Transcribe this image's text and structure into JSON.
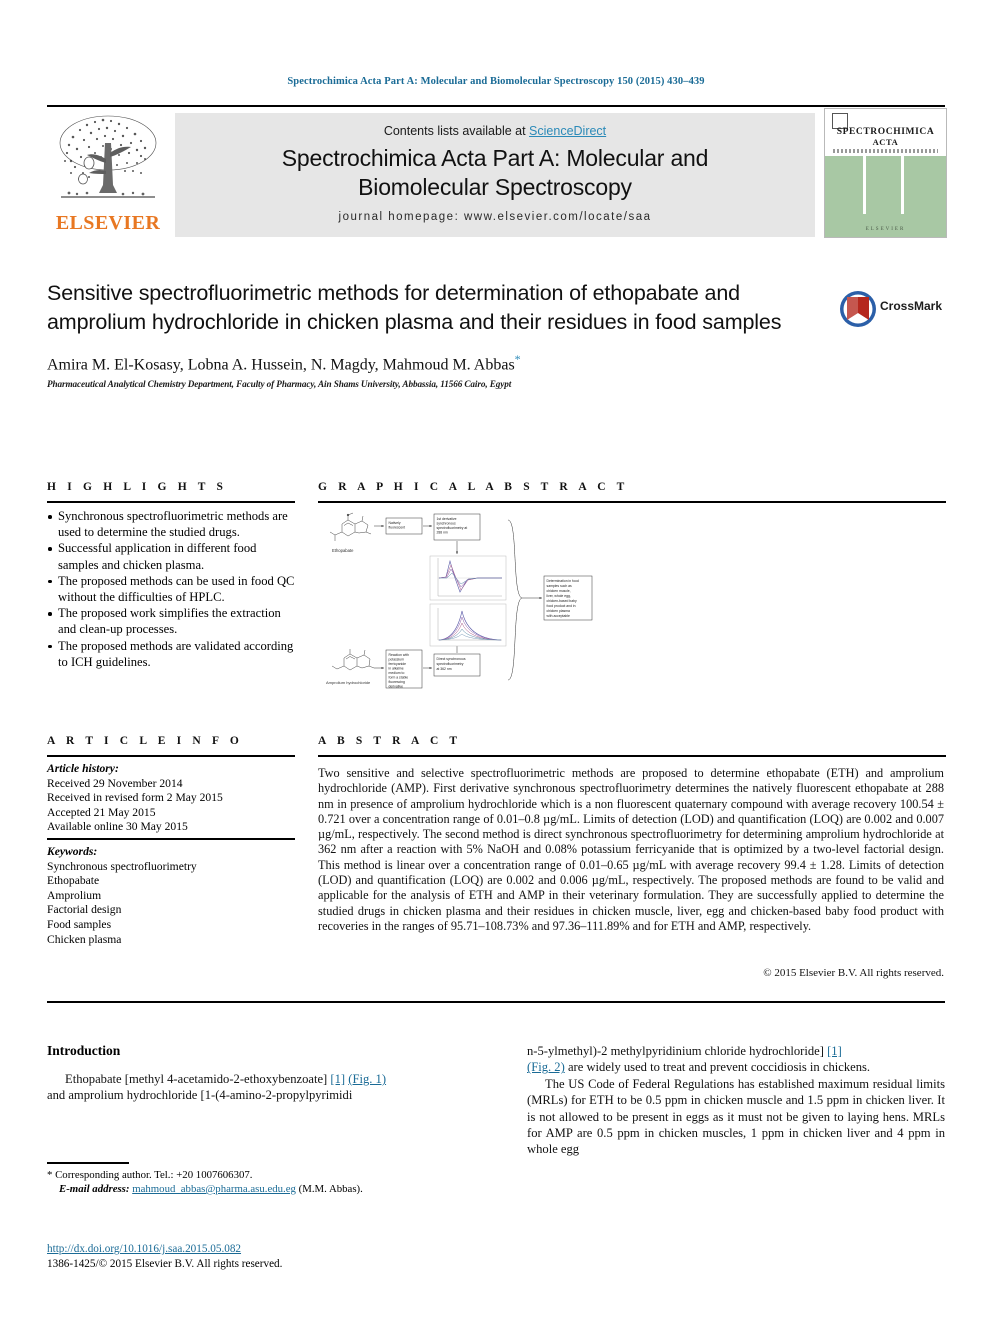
{
  "running_head": "Spectrochimica Acta Part A: Molecular and Biomolecular Spectroscopy 150 (2015) 430–439",
  "masthead": {
    "contents_prefix": "Contents lists available at ",
    "sciencedirect": "ScienceDirect",
    "journal_title_line1": "Spectrochimica Acta Part A: Molecular and",
    "journal_title_line2": "Biomolecular Spectroscopy",
    "homepage": "journal homepage: www.elsevier.com/locate/saa",
    "publisher": "ELSEVIER",
    "cover": {
      "line1": "SPECTROCHIMICA",
      "line2": "ACTA",
      "caption": "ELSEVIER"
    }
  },
  "article": {
    "title": "Sensitive spectrofluorimetric methods for determination of ethopabate and amprolium hydrochloride in chicken plasma and their residues in food samples",
    "authors": "Amira M. El-Kosasy, Lobna A. Hussein, N. Magdy, Mahmoud M. Abbas",
    "corresponding_mark": "*",
    "affiliation": "Pharmaceutical Analytical Chemistry Department, Faculty of Pharmacy, Ain Shams University, Abbassia, 11566 Cairo, Egypt",
    "crossmark_label": "CrossMark"
  },
  "highlights": {
    "heading": "H I G H L I G H T S",
    "items": [
      "Synchronous spectrofluorimetric methods are used to determine the studied drugs.",
      "Successful application in different food samples and chicken plasma.",
      "The proposed methods can be used in food QC without the difficulties of HPLC.",
      "The proposed work simplifies the extraction and clean-up processes.",
      "The proposed methods are validated according to ICH guidelines."
    ]
  },
  "graphical_abstract": {
    "heading": "G R A P H I C A L   A B S T R A C T",
    "nodes": {
      "ethopabate_label": "Ethopabate",
      "amprolium_label": "Amprolium hydrochloride",
      "box_natively": "Natively fluorescent",
      "box_first_deriv": "1st derivative synchronous spectrofluorimetry at 288 nm",
      "box_reaction": "Reaction with potassium ferricyanide in alkaline medium to form a stable fluorescing derivative",
      "box_direct": "Direct synchronous spectrofluorimetry at 362 nm",
      "box_result": "Determination in food samples such as chicken muscle, liver, whole egg, chicken-based baby food product and in chicken plasma with acceptable recoveries"
    }
  },
  "article_info": {
    "heading": "A R T I C L E   I N F O",
    "history_label": "Article history:",
    "history": [
      "Received 29 November 2014",
      "Received in revised form 2 May 2015",
      "Accepted 21 May 2015",
      "Available online 30 May 2015"
    ],
    "keywords_label": "Keywords:",
    "keywords": [
      "Synchronous spectrofluorimetry",
      "Ethopabate",
      "Amprolium",
      "Factorial design",
      "Food samples",
      "Chicken plasma"
    ]
  },
  "abstract": {
    "heading": "A B S T R A C T",
    "text": "Two sensitive and selective spectrofluorimetric methods are proposed to determine ethopabate (ETH) and amprolium hydrochloride (AMP). First derivative synchronous spectrofluorimetry determines the natively fluorescent ethopabate at 288 nm in presence of amprolium hydrochloride which is a non fluorescent quaternary compound with average recovery 100.54 ± 0.721 over a concentration range of 0.01–0.8 µg/mL. Limits of detection (LOD) and quantification (LOQ) are 0.002 and 0.007 µg/mL, respectively. The second method is direct synchronous spectrofluorimetry for determining amprolium hydrochloride at 362 nm after a reaction with 5% NaOH and 0.08% potassium ferricyanide that is optimized by a two-level factorial design. This method is linear over a concentration range of 0.01–0.65 µg/mL with average recovery 99.4 ± 1.28. Limits of detection (LOD) and quantification (LOQ) are 0.002 and 0.006 µg/mL, respectively. The proposed methods are found to be valid and applicable for the analysis of ETH and AMP in their veterinary formulation. They are successfully applied to determine the studied drugs in chicken plasma and their residues in chicken muscle, liver, egg and chicken-based baby food product with recoveries in the ranges of 95.71–108.73% and 97.36–111.89% and for ETH and AMP, respectively.",
    "copyright": "© 2015 Elsevier B.V. All rights reserved."
  },
  "body": {
    "intro_heading": "Introduction",
    "left_para_1a": "Ethopabate [methyl 4-acetamido-2-ethoxybenzoate]",
    "left_ref_1": "[1]",
    "left_fig_1": "(Fig. 1)",
    "left_para_1b": "and amprolium hydrochloride [1-(4-amino-2-propylpyrimidi",
    "right_para_1a": "n-5-ylmethyl)-2 methylpyridinium chloride hydrochloride]",
    "right_ref_1": "[1]",
    "right_fig_2": "(Fig. 2)",
    "right_para_1b": "are widely used to treat and prevent coccidiosis in chickens.",
    "right_para_2": "The US Code of Federal Regulations has established maximum residual limits (MRLs) for ETH to be 0.5 ppm in chicken muscle and 1.5 ppm in chicken liver. It is not allowed to be present in eggs as it must not be given to laying hens. MRLs for AMP are 0.5 ppm in chicken muscles, 1 ppm in chicken liver and 4 ppm in whole egg"
  },
  "footnote": {
    "star": "*",
    "corresponding": "Corresponding author. Tel.: +20 1007606307.",
    "email_label": "E-mail address:",
    "email": "mahmoud_abbas@pharma.asu.edu.eg",
    "email_owner": "(M.M. Abbas).",
    "doi": "http://dx.doi.org/10.1016/j.saa.2015.05.082",
    "issn_line": "1386-1425/© 2015 Elsevier B.V. All rights reserved."
  },
  "colors": {
    "link_blue": "#1a6b96",
    "sciencedirect_blue": "#2b8ab8",
    "elsevier_orange": "#E87722",
    "cover_green": "#a8c8a4",
    "masthead_gray": "#e6e6e6"
  }
}
